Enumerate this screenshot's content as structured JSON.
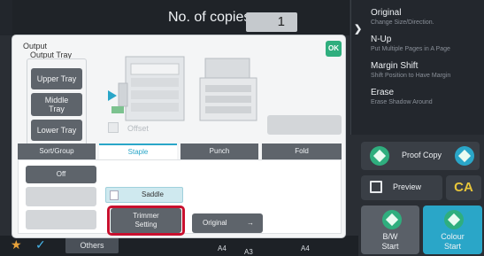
{
  "header": {
    "copies_label": "No. of copies",
    "copies_value": "1"
  },
  "right_panel": {
    "items": [
      {
        "title": "Original",
        "sub": "Change Size/Direction."
      },
      {
        "title": "N-Up",
        "sub": "Put Multiple Pages in A Page"
      },
      {
        "title": "Margin Shift",
        "sub": "Shift Position to Have Margin"
      },
      {
        "title": "Erase",
        "sub": "Erase Shadow Around"
      }
    ],
    "proof_copy": "Proof Copy",
    "preview": "Preview",
    "ca": "CA",
    "bw_start": "B/W\nStart",
    "colour_start": "Colour\nStart"
  },
  "dialog": {
    "title": "Output",
    "ok": "OK",
    "output_tray_label": "Output Tray",
    "trays": [
      "Upper Tray",
      "Middle\nTray",
      "Lower Tray"
    ],
    "offset_label": "Offset",
    "disabled_right_label": "",
    "tabs": [
      "Sort/Group",
      "Staple",
      "Punch",
      "Fold"
    ],
    "active_tab": "Staple",
    "options": {
      "off": "Off",
      "saddle": "Saddle",
      "trimmer": "Trimmer\nSetting",
      "original": "Original"
    }
  },
  "bottom": {
    "others": "Others",
    "trays": [
      "A4",
      "A4",
      "A3"
    ]
  },
  "colors": {
    "accent_blue": "#2aa6c8",
    "ok_green": "#2fae7e",
    "highlight_red": "#c8102e",
    "ca_yellow": "#e8c63a"
  }
}
